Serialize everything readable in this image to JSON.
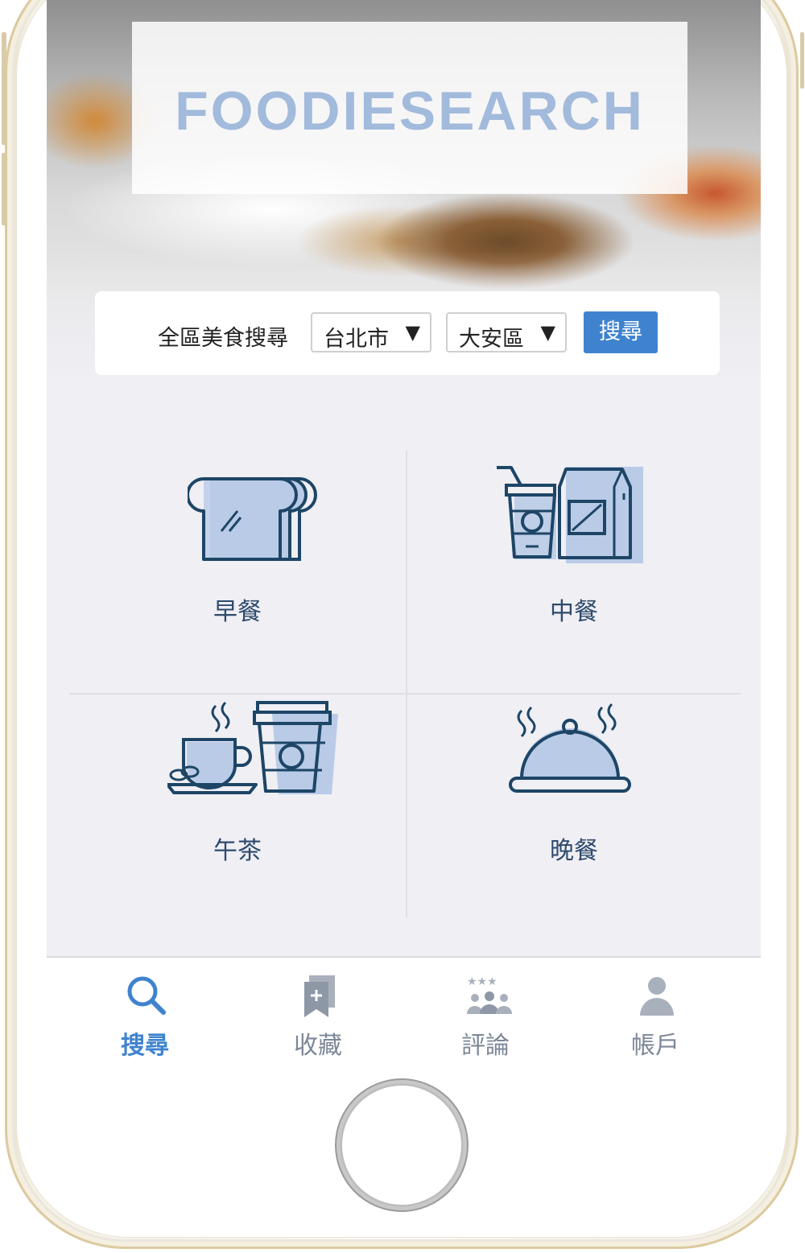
{
  "app": {
    "logo": "FOODIESEARCH"
  },
  "search": {
    "label": "全區美食搜尋",
    "city": "台北市",
    "district": "大安區",
    "dropdown_arrow": "▼",
    "button": "搜尋"
  },
  "categories": [
    {
      "label": "早餐",
      "icon": "bread-icon"
    },
    {
      "label": "中餐",
      "icon": "lunch-drink-bag-icon"
    },
    {
      "label": "午茶",
      "icon": "coffee-cups-icon"
    },
    {
      "label": "晚餐",
      "icon": "cloche-icon"
    }
  ],
  "tabs": [
    {
      "label": "搜尋",
      "icon": "search-icon",
      "active": true
    },
    {
      "label": "收藏",
      "icon": "bookmark-add-icon",
      "active": false
    },
    {
      "label": "評論",
      "icon": "rated-users-icon",
      "active": false
    },
    {
      "label": "帳戶",
      "icon": "user-icon",
      "active": false
    }
  ],
  "colors": {
    "accent": "#3f83cf",
    "icon_stroke": "#1d4566",
    "icon_fill": "#b9cbe7",
    "logo": "#a2badb",
    "tab_inactive": "#7c8797"
  }
}
